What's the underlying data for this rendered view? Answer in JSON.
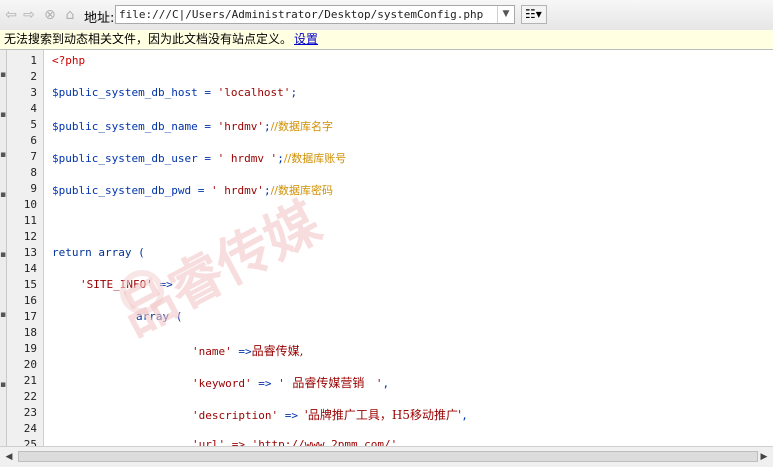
{
  "address_bar": {
    "back_icon": "back-arrow-icon",
    "forward_icon": "forward-arrow-icon",
    "stop_icon": "stop-icon",
    "home_icon": "home-icon",
    "label": "地址:",
    "url": "file:///C|/Users/Administrator/Desktop/systemConfig.php",
    "options_icon": "page-options-icon"
  },
  "info_bar": {
    "message": "无法搜索到动态相关文件，因为此文档没有站点定义。",
    "link": "设置"
  },
  "gutter": {
    "line_numbers": [
      "1",
      "2",
      "3",
      "4",
      "5",
      "6",
      "7",
      "8",
      "9",
      "10",
      "11",
      "12",
      "13",
      "14",
      "15",
      "16",
      "17",
      "18",
      "19",
      "20",
      "21",
      "22",
      "23",
      "24",
      "25"
    ]
  },
  "code": {
    "l1_tag": "<?php",
    "l3_var": "$public_system_db_host",
    "l3_eq": " = ",
    "l3_str": "'localhost'",
    "l3_end": ";",
    "l5_var": "$public_system_db_name",
    "l5_eq": " = ",
    "l5_str": "'hrdmv'",
    "l5_end": ";",
    "l5_cmt": "//数据库名字",
    "l7_var": "$public_system_db_user",
    "l7_eq": " = ",
    "l7_str": "' hrdmv '",
    "l7_end": ";",
    "l7_cmt": "//数据库账号",
    "l9_var": "$public_system_db_pwd",
    "l9_eq": " = ",
    "l9_str": "' hrdmv'",
    "l9_end": ";",
    "l9_cmt": "//数据库密码",
    "l13": "return array (",
    "l15_str": "'SITE_INFO'",
    "l15_op": " =>",
    "l17": "array (",
    "l19_key": "'name'",
    "l19_op": " =>",
    "l19_val": "品睿传媒,",
    "l21_key": "'keyword'",
    "l21_op": " => ",
    "l21_q1": "'",
    "l21_val": "  品睿传媒营销   ",
    "l21_q2": "'",
    "l21_end": ",",
    "l23_key": "'description'",
    "l23_op": " => ",
    "l23_val": "'品牌推广工具，H5移动推广'",
    "l23_end": ",",
    "l25_partial": "'url' => 'http://www.2pmm.com/'"
  },
  "watermark": "品睿传媒",
  "colors": {
    "php_tag": "#cc0000",
    "variable": "#0033aa",
    "string": "#990000",
    "comment": "#d09000",
    "info_bar_bg": "#ffffe1"
  }
}
